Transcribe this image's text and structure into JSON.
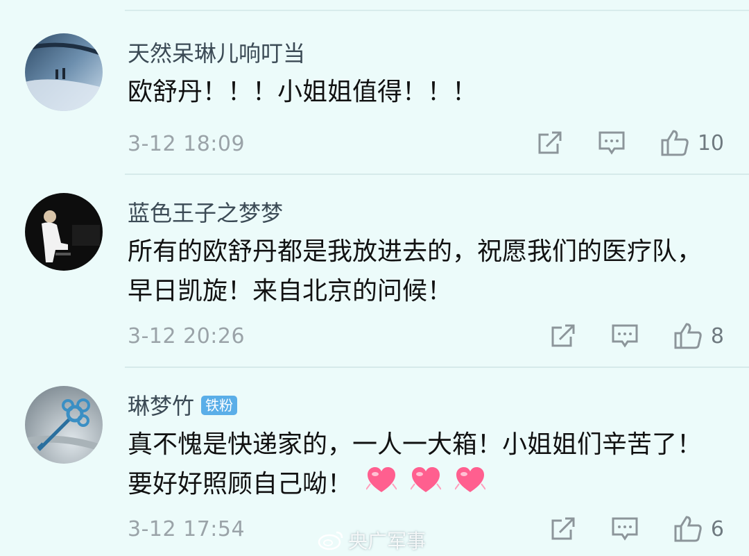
{
  "comments": [
    {
      "username": "天然呆琳儿响叮当",
      "text": "欧舒丹！！！小姐姐值得！！！",
      "time": "3-12 18:09",
      "likes": "10",
      "avatar_icon": "car-window-avatar"
    },
    {
      "username": "蓝色王子之梦梦",
      "text": "所有的欧舒丹都是我放进去的，祝愿我们的医疗队，早日凯旋！来自北京的问候！",
      "time": "3-12 20:26",
      "likes": "8",
      "avatar_icon": "pianist-avatar"
    },
    {
      "username": "琳梦竹",
      "badge": "铁粉",
      "text": "真不愧是快递家的，一人一大箱！小姐姐们辛苦了！要好好照顾自己呦！",
      "time": "3-12 17:54",
      "likes": "6",
      "avatar_icon": "key-avatar",
      "emojis": [
        "heart-emoji",
        "heart-emoji",
        "heart-emoji"
      ]
    }
  ],
  "watermark": "央广军事",
  "colors": {
    "background": "#ecfbfa",
    "username": "#3b4a55",
    "timestamp": "#9aa3a8",
    "badge": "#5aaee8",
    "heart": "#ff5f8f"
  }
}
